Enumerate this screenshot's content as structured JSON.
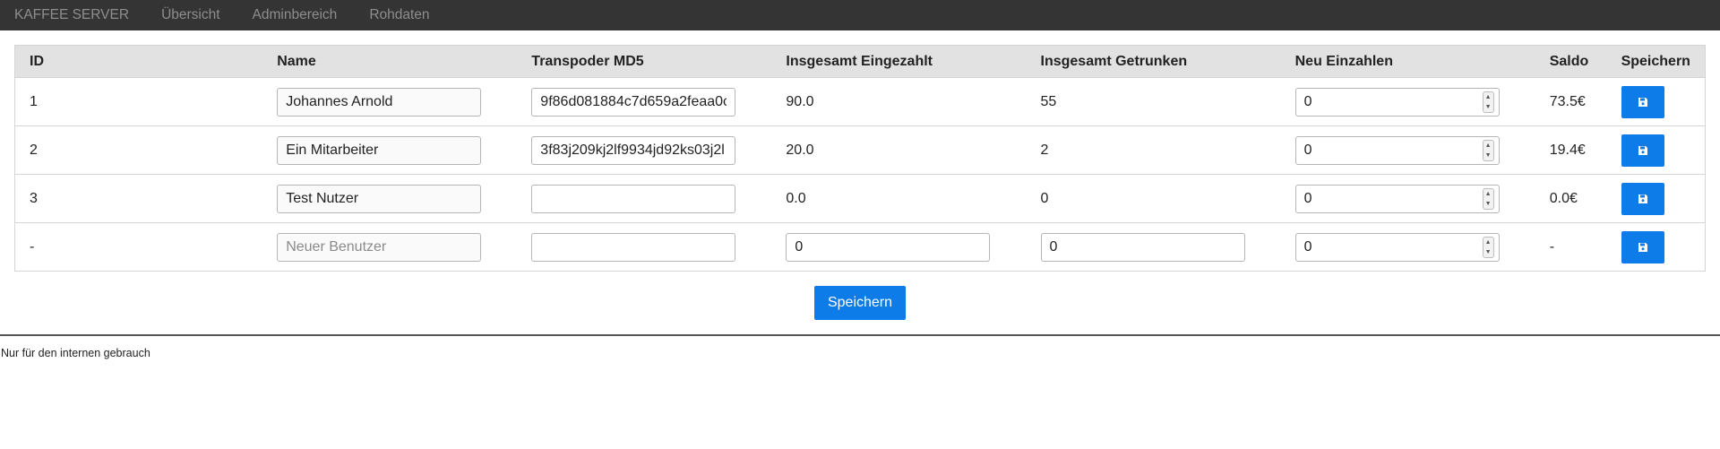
{
  "nav": {
    "brand": "KAFFEE SERVER",
    "items": [
      "Übersicht",
      "Adminbereich",
      "Rohdaten"
    ]
  },
  "table": {
    "headers": [
      "ID",
      "Name",
      "Transpoder MD5",
      "Insgesamt Eingezahlt",
      "Insgesamt Getrunken",
      "Neu Einzahlen",
      "Saldo",
      "Speichern"
    ],
    "rows": [
      {
        "id": "1",
        "name": "Johannes Arnold",
        "md5": "9f86d081884c7d659a2feaa0c",
        "paid": "90.0",
        "drunk": "55",
        "deposit": "0",
        "saldo": "73.5€"
      },
      {
        "id": "2",
        "name": "Ein Mitarbeiter",
        "md5": "3f83j209kj2lf9934jd92ks03j2l",
        "paid": "20.0",
        "drunk": "2",
        "deposit": "0",
        "saldo": "19.4€"
      },
      {
        "id": "3",
        "name": "Test Nutzer",
        "md5": "",
        "paid": "0.0",
        "drunk": "0",
        "deposit": "0",
        "saldo": "0.0€"
      }
    ],
    "new_row": {
      "id": "-",
      "name_placeholder": "Neuer Benutzer",
      "md5": "",
      "paid": "0",
      "drunk": "0",
      "deposit": "0",
      "saldo": "-"
    }
  },
  "save_all_label": "Speichern",
  "footer_text": "Nur für den internen gebrauch",
  "colors": {
    "accent": "#0d7be8",
    "navbar": "#343434"
  },
  "icons": {
    "row_save": "floppy-disk-icon"
  }
}
